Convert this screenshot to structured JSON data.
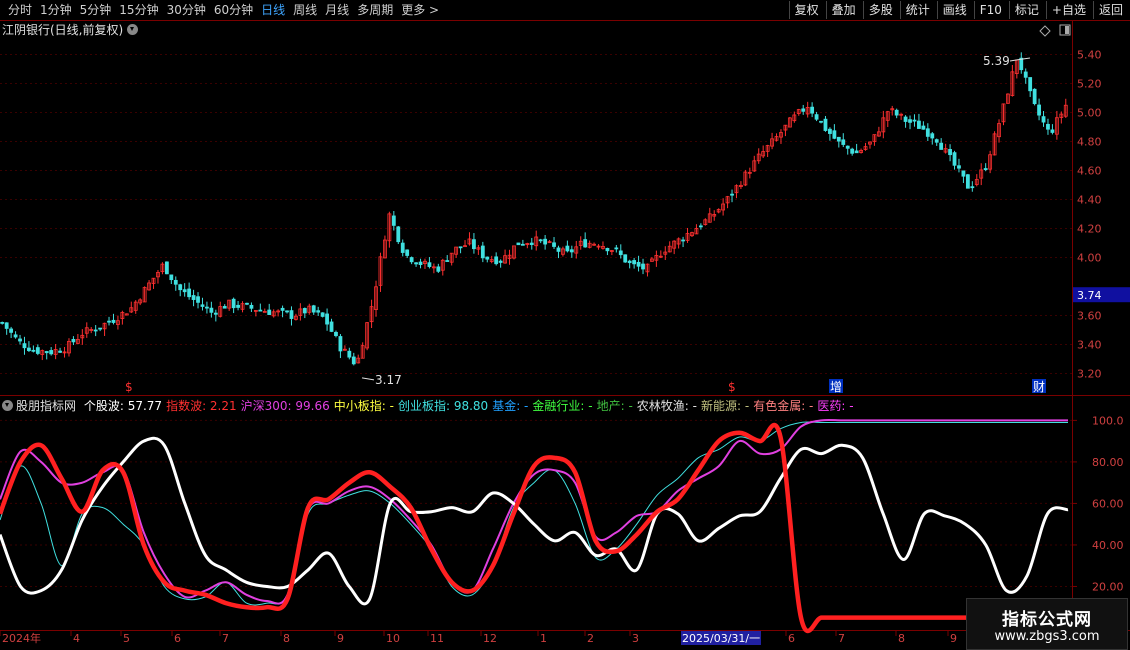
{
  "toolbar": {
    "periods": [
      "分时",
      "1分钟",
      "5分钟",
      "15分钟",
      "30分钟",
      "60分钟",
      "日线",
      "周线",
      "月线",
      "多周期",
      "更多 >"
    ],
    "active_period": "日线",
    "right_buttons": [
      "复权",
      "叠加",
      "多股",
      "统计",
      "画线",
      "F10",
      "标记",
      "+自选",
      "返回"
    ]
  },
  "main_chart": {
    "title": "江阴银行(日线,前复权)",
    "price_axis": [
      "5.40",
      "5.20",
      "5.00",
      "4.80",
      "4.60",
      "4.40",
      "4.20",
      "4.00",
      "3.60",
      "3.40",
      "3.20"
    ],
    "current_price_label": "3.74",
    "high_label": "5.39",
    "low_label": "3.17",
    "event_marks": [
      "$",
      "$",
      "增",
      "财"
    ]
  },
  "indicator": {
    "name": "股朋指标网",
    "items": [
      {
        "label": "个股波:",
        "value": "57.77",
        "color": "#ffffff"
      },
      {
        "label": "指数波:",
        "value": "2.21",
        "color": "#ff3030"
      },
      {
        "label": "沪深300:",
        "value": "99.66",
        "color": "#e040e0"
      },
      {
        "label": "中小板指:",
        "value": "-",
        "color": "#ffff40"
      },
      {
        "label": "创业板指:",
        "value": "98.80",
        "color": "#40e0e0"
      },
      {
        "label": "基金:",
        "value": "-",
        "color": "#20a0ff"
      },
      {
        "label": "金融行业:",
        "value": "-",
        "color": "#40ff40"
      },
      {
        "label": "地产:",
        "value": "-",
        "color": "#40c040"
      },
      {
        "label": "农林牧渔:",
        "value": "-",
        "color": "#e0e0e0"
      },
      {
        "label": "新能源:",
        "value": "-",
        "color": "#c0c080"
      },
      {
        "label": "有色金属:",
        "value": "-",
        "color": "#ff8080"
      },
      {
        "label": "医药:",
        "value": "-",
        "color": "#ff40ff"
      }
    ],
    "axis": [
      "100.0",
      "80.00",
      "60.00",
      "40.00",
      "20.00"
    ]
  },
  "time_axis": {
    "labels": [
      "2024年",
      "4",
      "5",
      "6",
      "7",
      "8",
      "9",
      "10",
      "11",
      "12",
      "1",
      "2",
      "3",
      "2025/03/31/一",
      "6",
      "7",
      "8",
      "9"
    ]
  },
  "watermark": {
    "title": "指标公式网",
    "url": "www.zbgs3.com"
  },
  "chart_data": {
    "type": "line",
    "title": "江阴银行(日线,前复权)",
    "price_range": [
      3.1,
      5.5
    ],
    "price_high": 5.39,
    "price_low": 3.17,
    "price_close_points": [
      3.55,
      3.42,
      3.36,
      3.35,
      3.38,
      3.48,
      3.52,
      3.58,
      3.65,
      3.8,
      3.95,
      3.78,
      3.7,
      3.62,
      3.68,
      3.66,
      3.64,
      3.62,
      3.6,
      3.64,
      3.58,
      3.38,
      3.26,
      3.7,
      4.3,
      4.02,
      3.96,
      3.92,
      4.05,
      4.1,
      4.0,
      3.98,
      4.1,
      4.12,
      4.08,
      4.02,
      4.1,
      4.1,
      4.05,
      3.95,
      3.92,
      4.05,
      4.12,
      4.2,
      4.28,
      4.4,
      4.55,
      4.7,
      4.82,
      4.95,
      5.05,
      4.9,
      4.78,
      4.72,
      4.8,
      5.02,
      4.95,
      4.9,
      4.82,
      4.65,
      4.48,
      4.62,
      4.98,
      5.39,
      5.05,
      4.85,
      5.05
    ],
    "series": [
      {
        "name": "个股波",
        "color": "#ffffff",
        "values": [
          45,
          20,
          18,
          28,
          52,
          68,
          80,
          90,
          88,
          60,
          35,
          28,
          22,
          20,
          20,
          28,
          36,
          20,
          14,
          60,
          56,
          56,
          58,
          56,
          65,
          60,
          50,
          42,
          46,
          35,
          38,
          28,
          55,
          55,
          42,
          48,
          54,
          56,
          72,
          86,
          84,
          88,
          82,
          55,
          33,
          55,
          54,
          50,
          40,
          18,
          25,
          55,
          57
        ]
      },
      {
        "name": "指数波",
        "color": "#ff2020",
        "values": [
          55,
          80,
          88,
          72,
          56,
          76,
          75,
          40,
          22,
          18,
          16,
          12,
          10,
          10,
          14,
          58,
          62,
          70,
          75,
          68,
          58,
          38,
          22,
          18,
          30,
          55,
          78,
          82,
          75,
          42,
          37,
          45,
          56,
          62,
          76,
          90,
          94,
          90,
          92,
          5,
          5,
          5,
          5,
          5,
          5,
          5,
          5,
          5,
          5,
          5,
          5,
          5,
          5
        ]
      },
      {
        "name": "沪深300",
        "color": "#e040e0",
        "values": [
          62,
          85,
          80,
          70,
          70,
          75,
          76,
          46,
          26,
          15,
          18,
          22,
          16,
          13,
          16,
          57,
          60,
          66,
          68,
          62,
          52,
          40,
          22,
          18,
          38,
          60,
          74,
          76,
          70,
          44,
          46,
          54,
          56,
          66,
          72,
          78,
          90,
          84,
          86,
          97,
          100,
          100,
          100,
          100,
          100,
          100,
          100,
          100,
          100,
          100,
          100,
          100,
          100
        ]
      },
      {
        "name": "创业板指",
        "color": "#40e0e0",
        "values": [
          52,
          78,
          60,
          30,
          55,
          58,
          50,
          40,
          20,
          14,
          15,
          22,
          12,
          12,
          16,
          55,
          60,
          64,
          66,
          60,
          50,
          38,
          20,
          16,
          30,
          58,
          70,
          76,
          60,
          34,
          38,
          50,
          64,
          72,
          82,
          86,
          92,
          90,
          96,
          99,
          99,
          99,
          99,
          99,
          99,
          99,
          99,
          99,
          99,
          99,
          99,
          99,
          99
        ]
      }
    ],
    "indicator_range": [
      0,
      105
    ]
  }
}
